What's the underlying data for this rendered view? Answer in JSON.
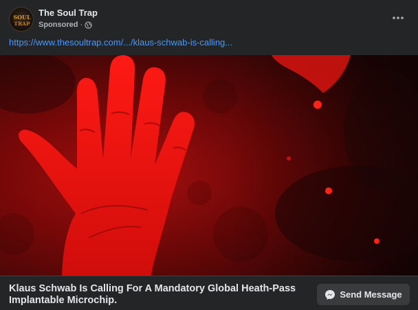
{
  "header": {
    "page_name": "The Soul Trap",
    "sponsored_label": "Sponsored",
    "separator": "·",
    "audience_icon": "globe-icon",
    "more_icon": "more-horizontal-icon",
    "avatar_text": "SOUL TRAP"
  },
  "link": {
    "url_text": "https://www.thesoultrap.com/.../klaus-schwab-is-calling..."
  },
  "image": {
    "subject": "red-hand-image"
  },
  "footer": {
    "headline": "Klaus Schwab Is Calling For A Mandatory Global Heath-Pass Implantable Microchip.",
    "cta_label": "Send Message",
    "cta_icon": "messenger-icon"
  },
  "colors": {
    "background": "#242526",
    "text_primary": "#e4e6eb",
    "text_secondary": "#b0b3b8",
    "link": "#4599ff",
    "button_bg": "#3a3b3c",
    "image_red": "#c4100f"
  }
}
